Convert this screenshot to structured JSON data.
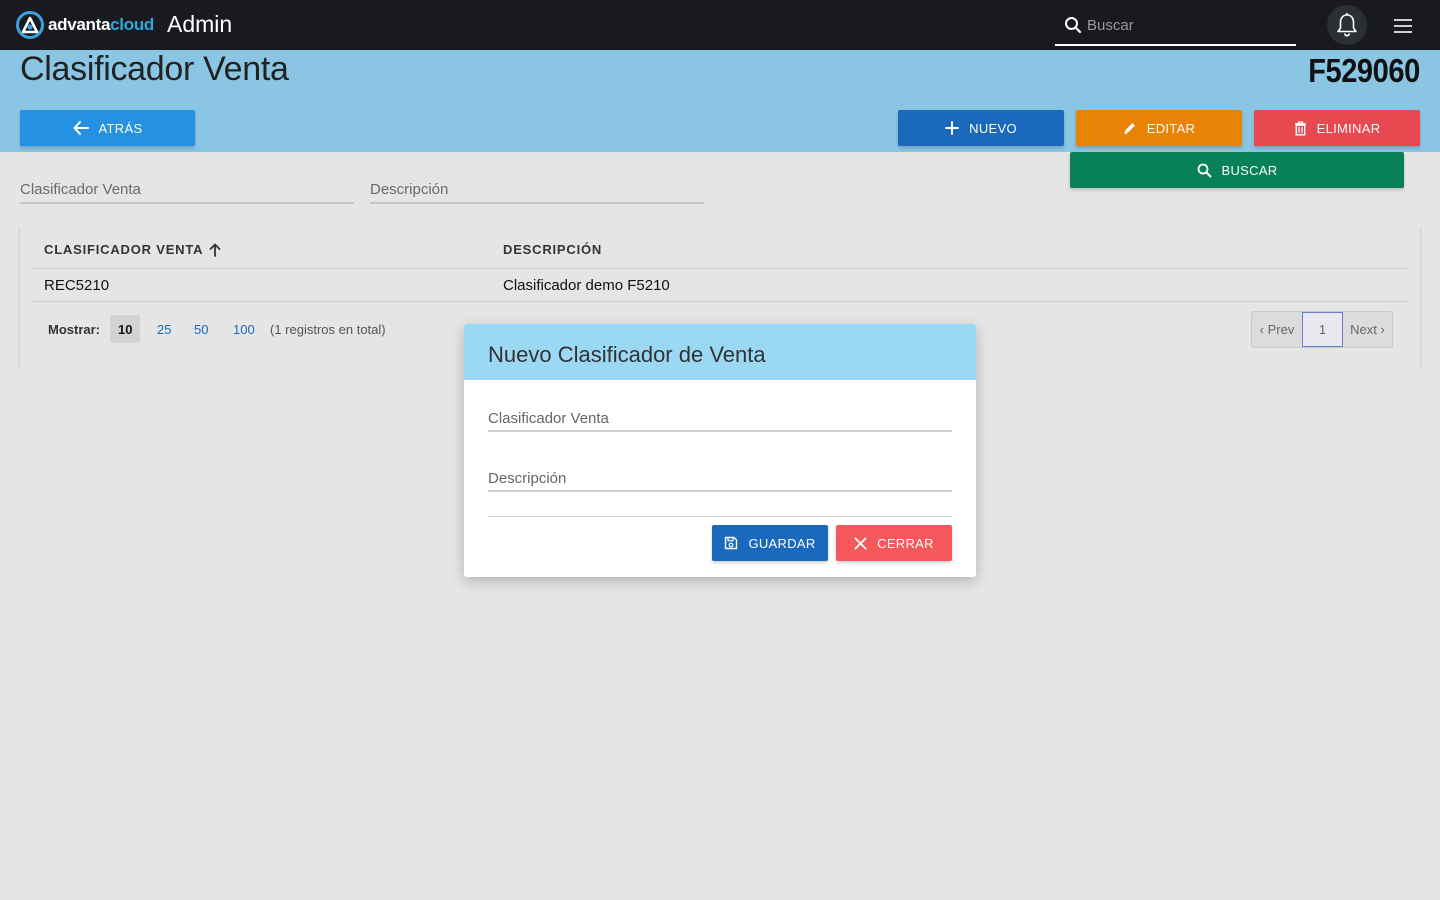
{
  "app": {
    "logo_main": "advanta",
    "logo_accent": "cloud",
    "title": "Admin"
  },
  "header_search": {
    "placeholder": "Buscar"
  },
  "page": {
    "title": "Clasificador Venta",
    "record_code": "F529060"
  },
  "toolbar": {
    "back_label": "ATRÁS",
    "new_label": "NUEVO",
    "edit_label": "EDITAR",
    "delete_label": "ELIMINAR",
    "search_label": "BUSCAR"
  },
  "filters": {
    "clasificador_placeholder": "Clasificador Venta",
    "descripcion_placeholder": "Descripción"
  },
  "table": {
    "columns": [
      "CLASIFICADOR VENTA",
      "DESCRIPCIÓN"
    ],
    "sort_column": "CLASIFICADOR VENTA",
    "rows": [
      {
        "clasificador": "REC5210",
        "descripcion": "Clasificador demo F5210"
      }
    ]
  },
  "pagination": {
    "show_label": "Mostrar:",
    "page_sizes": [
      "10",
      "25",
      "50",
      "100"
    ],
    "selected_page_size": "10",
    "total_text": "(1 registros en total)",
    "prev_label": "‹ Prev",
    "current_page": "1",
    "next_label": "Next ›"
  },
  "modal": {
    "title": "Nuevo Clasificador de Venta",
    "field_clasificador_placeholder": "Clasificador Venta",
    "field_descripcion_placeholder": "Descripción",
    "save_label": "GUARDAR",
    "close_label": "CERRAR"
  },
  "colors": {
    "topbar": "#181a1f",
    "band": "#8ac5e3",
    "back": "#2491e3",
    "new": "#1a69bd",
    "edit": "#e88306",
    "delete": "#e84850",
    "search": "#08815a",
    "modal_header": "#9ad8f4",
    "close": "#f4585c"
  }
}
